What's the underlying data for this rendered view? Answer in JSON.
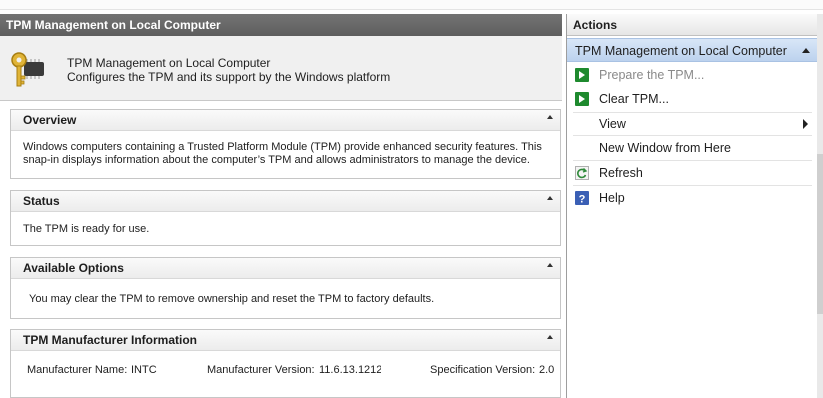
{
  "main": {
    "title": "TPM Management on Local Computer",
    "intro": {
      "line1": "TPM Management on Local Computer",
      "line2": "Configures the TPM and its support by the Windows platform",
      "icon": "key-chip-icon"
    },
    "sections": {
      "overview": {
        "title": "Overview",
        "line1": "Windows computers containing a Trusted Platform Module (TPM) provide enhanced security features. This",
        "line2": "snap-in displays information about the computer’s TPM and allows administrators to manage the device."
      },
      "status": {
        "title": "Status",
        "text": "The TPM is ready for use."
      },
      "options": {
        "title": "Available Options",
        "text": "You may clear the TPM to remove ownership and reset the TPM to factory defaults."
      },
      "manufacturer": {
        "title": "TPM Manufacturer Information",
        "name_label": "Manufacturer Name:",
        "name_value": "INTC",
        "version_label": "Manufacturer Version:",
        "version_value": "11.6.13.1212",
        "spec_label": "Specification Version:",
        "spec_value": "2.0"
      }
    }
  },
  "actions": {
    "title": "Actions",
    "group": "TPM Management on Local Computer",
    "items": [
      {
        "label": "Prepare the TPM...",
        "icon": "green-arrow-icon",
        "disabled": true
      },
      {
        "label": "Clear TPM...",
        "icon": "green-arrow-icon",
        "disabled": false
      },
      {
        "label": "View",
        "icon": "",
        "submenu": true
      },
      {
        "label": "New Window from Here",
        "icon": ""
      },
      {
        "label": "Refresh",
        "icon": "refresh-icon"
      },
      {
        "label": "Help",
        "icon": "help-icon"
      }
    ]
  },
  "colors": {
    "title_bar": "#666666",
    "action_highlight": "#c8dbf2",
    "green_icon": "#1e8a2e",
    "help_icon": "#3a5fb5"
  }
}
